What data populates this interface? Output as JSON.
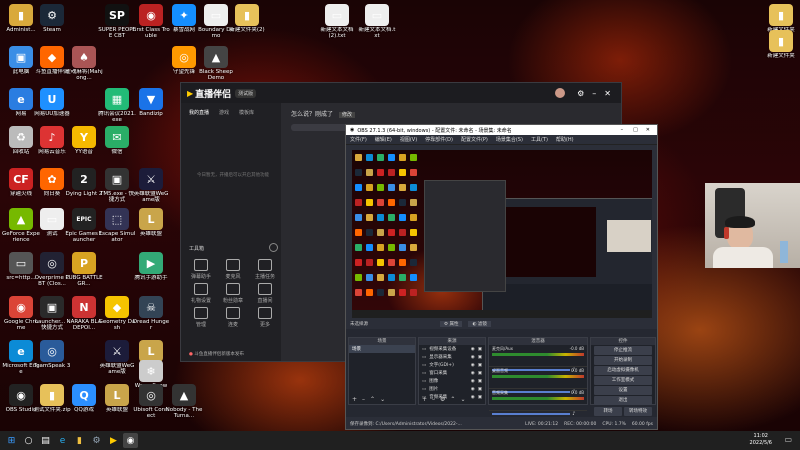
{
  "desktop": {
    "icons": [
      {
        "label": "Administ...",
        "color": "#d9a93c",
        "glyph": "▮"
      },
      {
        "label": "Steam",
        "color": "#1b2838",
        "glyph": "⚙"
      },
      {
        "label": "SUPER PEOPLE CBT",
        "color": "#111",
        "glyph": "SP"
      },
      {
        "label": "First Class Trouble",
        "color": "#b22",
        "glyph": "◉"
      },
      {
        "label": "暴雪战网",
        "color": "#148eff",
        "glyph": "✦"
      },
      {
        "label": "Boundary Demo",
        "color": "#eee",
        "glyph": "▭"
      },
      {
        "label": "新建文件夹(2)",
        "color": "#e7c15a",
        "glyph": "▮"
      },
      {
        "label": "新建文本文档(2).txt",
        "color": "#eee",
        "glyph": "▭"
      },
      {
        "label": "新建文本文档.txt",
        "color": "#eee",
        "glyph": "▭"
      },
      {
        "label": "新建文件夹",
        "color": "#e7c15a",
        "glyph": "▮"
      },
      {
        "label": "此电脑",
        "color": "#3a8ee6",
        "glyph": "▣"
      },
      {
        "label": "斗鱼直播伴侣",
        "color": "#f60",
        "glyph": "◆"
      },
      {
        "label": "雀魂麻将(Mahjong...",
        "color": "#a55",
        "glyph": "♠"
      },
      {
        "label": "守望先锋",
        "color": "#f90",
        "glyph": "◎"
      },
      {
        "label": "Black Sheep Demo",
        "color": "#444",
        "glyph": "▲"
      },
      {
        "label": "网易",
        "color": "#2a7de1",
        "glyph": "e"
      },
      {
        "label": "网易UU加速器",
        "color": "#1e90ff",
        "glyph": "U"
      },
      {
        "label": "腾讯会议2021.exe",
        "color": "#2b7",
        "glyph": "▦"
      },
      {
        "label": "Bandizip",
        "color": "#1a73e8",
        "glyph": "▼"
      },
      {
        "label": "回收站",
        "color": "#bbb",
        "glyph": "♻"
      },
      {
        "label": "网易云音乐",
        "color": "#d33",
        "glyph": "♪"
      },
      {
        "label": "YY语音",
        "color": "#f5b800",
        "glyph": "Y"
      },
      {
        "label": "微信",
        "color": "#2aae67",
        "glyph": "✉"
      },
      {
        "label": "穿越火线",
        "color": "#c22",
        "glyph": "CF"
      },
      {
        "label": "向日葵",
        "color": "#f60",
        "glyph": "✿"
      },
      {
        "label": "Dying Light 2",
        "color": "#222",
        "glyph": "2"
      },
      {
        "label": "TM5.exe - 快捷方式",
        "color": "#333",
        "glyph": "▣"
      },
      {
        "label": "英雄联盟WeGame版",
        "color": "#1c1c3a",
        "glyph": "⚔"
      },
      {
        "label": "GeForce Experience",
        "color": "#76b900",
        "glyph": "▲"
      },
      {
        "label": "测试",
        "color": "#eee",
        "glyph": "▭"
      },
      {
        "label": "Epic Games Launcher",
        "color": "#222",
        "glyph": "EPIC"
      },
      {
        "label": "Escape Simulator",
        "color": "#335",
        "glyph": "⬚"
      },
      {
        "label": "英雄联盟",
        "color": "#c9a54a",
        "glyph": "L"
      },
      {
        "label": "src=http...",
        "color": "#555",
        "glyph": "▭"
      },
      {
        "label": "Overprime CBT (Clos...",
        "color": "#223",
        "glyph": "◎"
      },
      {
        "label": "PUBG BATTLEGR...",
        "color": "#d8a322",
        "glyph": "P"
      },
      {
        "label": "腾讯手游助手",
        "color": "#3a7",
        "glyph": "▶"
      },
      {
        "label": "Google Chrome",
        "color": "#db4437",
        "glyph": "◉"
      },
      {
        "label": "Launcher... - 快捷方式",
        "color": "#2a2a2a",
        "glyph": "▣"
      },
      {
        "label": "NARAKA BLADEPOI...",
        "color": "#c33",
        "glyph": "N"
      },
      {
        "label": "Geometry Dash",
        "color": "#f5c400",
        "glyph": "◆"
      },
      {
        "label": "Dread Hunger",
        "color": "#345",
        "glyph": "☠"
      },
      {
        "label": "Microsoft Edge",
        "color": "#0c8bd6",
        "glyph": "e"
      },
      {
        "label": "TeamSpeak 3",
        "color": "#2a5b9a",
        "glyph": "◎"
      },
      {
        "label": "英雄联盟WeGame版",
        "color": "#1c1c3a",
        "glyph": "⚔"
      },
      {
        "label": "英雄联盟",
        "color": "#c9a54a",
        "glyph": "L"
      },
      {
        "label": "Warm Snow",
        "color": "#ccc",
        "glyph": "❄"
      },
      {
        "label": "OBS Studio",
        "color": "#222",
        "glyph": "◉"
      },
      {
        "label": "测试文件夹.zip",
        "color": "#e7c15a",
        "glyph": "▮"
      },
      {
        "label": "QQ游戏",
        "color": "#2b8fff",
        "glyph": "Q"
      },
      {
        "label": "英雄联盟",
        "color": "#c9a54a",
        "glyph": "L"
      },
      {
        "label": "Ubisoft Connect",
        "color": "#333",
        "glyph": "◎"
      },
      {
        "label": "Nobody - The Turna...",
        "color": "#333",
        "glyph": "▲"
      },
      {
        "label": "新建文件夹",
        "color": "#e7c15a",
        "glyph": "▮"
      }
    ]
  },
  "livehelper": {
    "logo": "直播伴侣",
    "badge": "测试版",
    "tabs": [
      "我的直播",
      "游戏",
      "模板库"
    ],
    "room_title": "怎么说？刚成了",
    "room_tag": "修改",
    "empty_hint": "今日暂无，开播后可以开启其他功能",
    "tools_label": "工具箱",
    "tools": [
      "弹幕助手",
      "麦克风",
      "主播任务",
      "礼物设置",
      "粉丝勋章",
      "直播间",
      "管理",
      "连麦",
      "更多"
    ],
    "bottom_notice": "斗鱼直播伴侣新版本发布",
    "center_btns": [
      "开播",
      "设置"
    ],
    "center_hint": "添加一个内容源"
  },
  "obs": {
    "title": "OBS 27.1.3 (64-bit, windows) - 配置文件: 未命名 - 场景集: 未命名",
    "menu": [
      "文件(F)",
      "编辑(E)",
      "视图(V)",
      "停靠部件(D)",
      "配置文件(P)",
      "场景集合(S)",
      "工具(T)",
      "帮助(H)"
    ],
    "no_source": "未选择源",
    "props_btn": "属性",
    "filter_btn": "滤镜",
    "panels": {
      "scenes": "场景",
      "sources": "来源",
      "mixer": "混音器",
      "transitions": "转场特效",
      "controls": "控件"
    },
    "scene_item": "场景",
    "sources": [
      "视频采集设备",
      "显示器采集",
      "文字(GDI+)",
      "窗口采集",
      "图像",
      "图片",
      "音频采集"
    ],
    "mixer": [
      {
        "name": "麦克风/Aux",
        "db": "-0.0 dB"
      },
      {
        "name": "桌面音频",
        "db": "0.0 dB"
      },
      {
        "name": "音频采集",
        "db": "0.0 dB"
      }
    ],
    "controls": [
      "停止推流",
      "开始录制",
      "启动虚拟摄像机",
      "工作室模式",
      "设置",
      "退出"
    ],
    "transition_label": "转场",
    "transition_btn": "转场特效",
    "status": [
      "LIVE: 00:21:12",
      "REC: 00:00:00",
      "CPU: 1.7%",
      "60.00 fps"
    ],
    "rec_path": "保存录像到: C:/Users/Administrator/Videos/2022-..."
  },
  "taskbar": {
    "time": "11:02",
    "date": "2022/5/6"
  }
}
